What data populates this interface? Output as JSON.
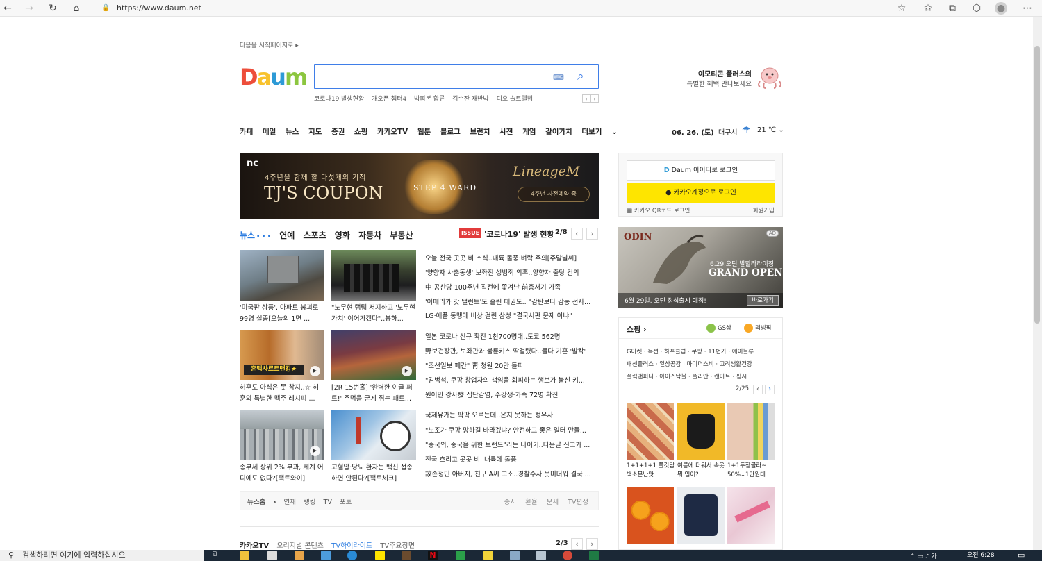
{
  "browser": {
    "url": "https://www.daum.net"
  },
  "header": {
    "start_page": "다음을 시작페이지로",
    "search": {
      "value": "",
      "placeholder": ""
    },
    "trending": [
      "코로나19 발생현황",
      "개오픈 챕터4",
      "박회본 합류",
      "김수잔 재반박",
      "디오 솔트엘범"
    ],
    "promo": {
      "title": "이모티콘 플러스의",
      "subtitle": "특별한 혜택 만나보세요"
    }
  },
  "nav": {
    "items": [
      "카페",
      "메일",
      "뉴스",
      "지도",
      "증권",
      "쇼핑",
      "카카오TV",
      "웹툰",
      "블로그",
      "브런치",
      "사전",
      "게임",
      "같이가치",
      "더보기"
    ],
    "date": "06. 26. (토)",
    "city": "대구시",
    "temp": "21 ℃"
  },
  "banner": {
    "brand": "nc",
    "tagline": "4주년을 함께 할 다섯개의 기적",
    "headline": "TJ'S COUPON",
    "center": "STEP 4 WARD",
    "game": "LineageM",
    "preregister": "4주년 사전예약 중"
  },
  "news": {
    "tabs": [
      "뉴스",
      "연예",
      "스포츠",
      "영화",
      "자동차",
      "부동산"
    ],
    "issue_tag": "ISSUE",
    "issue_title": "'코로나19' 발생 현황",
    "page": "2/8",
    "thumbs": [
      {
        "caption": "'미국판 삼풍'..아파트 붕괴로 99명 실종[오늘의 1면 ..."
      },
      {
        "caption": "\"노무현 탬퉤 저지하고 '노무현 가치' 이어가겠다\"..봉하..."
      },
      {
        "caption": "허훈도 아식은 못 참지..☆ 허훈의 특별한 맥주 레시피 ..."
      },
      {
        "caption": "[2R 15번홀] '완벽한 이글 퍼트!' 주먹을 굳게 쥐는 패트..."
      },
      {
        "caption": "종부세 상위 2% 부과, 세계 어디에도 없다?[팩트와이]"
      },
      {
        "caption": "고혈압·당뇨 환자는 백신 접종하면 안된다?[팩트체크]"
      }
    ],
    "headlines": [
      "오늘 전국 곳곳 비 소식..내륙 돌풍·벼락 주의[주말날씨]",
      "'양향자 사촌동생' 보좌진 성범죄 의혹..양향자 출당 건의",
      "中 공산당 100주년 직전에 쫓겨난 前총서기 가족",
      "'아메리카 갓 탤런트'도 홀린 태권도.. \"감탄보다 감동 선사...",
      "LG·애플 동맹에 비상 걸린 삼성 \"결국시판 문제 아냐\"",
      "일본 코로나 신규 확진 1천700명대..도쿄 562명",
      "野보건장관, 보좌관과 불륜키스 딱걸렸다..물다 기혼 '발칵'",
      "\"조선일보 폐간\" 靑 청원 20만 돌파",
      "\"김범석, 쿠팡 창업자의 책임을 회피하는 행보가 불신 키...",
      "원어민 강사發 집단감염, 수강생·가족 72명 확진",
      "국제유가는 팍팍 오르는데..온지 못하는 정유사",
      "\"노조가 쿠팡 망하길 바라겠냐? 안전하고 좋은 일터 만들...",
      "\"중국의, 중국을 위한 브랜드\"라는 나이키..다음날 신고가 ...",
      "전국 흐리고 곳곳 비..내륙에 돌풍",
      "故손정민 아버지, 친구 A씨 고소..경찰수사 못미더워 결국 ..."
    ],
    "footer_left": [
      "뉴스홈",
      "연재",
      "랭킹",
      "TV",
      "포토"
    ],
    "footer_right": [
      "증시",
      "환율",
      "운세",
      "TV편성"
    ]
  },
  "kakaotv": {
    "title": "카카오TV",
    "tabs": [
      "오리지널 콘텐츠",
      "TV하이라이트",
      "TV주요장면"
    ],
    "page": "2/3"
  },
  "login": {
    "daum": "Daum 아이디로 로그인",
    "kakao": "카카오계정으로 로그인",
    "qr": "카카오 QR코드 로그인",
    "join": "회원가입"
  },
  "ad": {
    "tag": "AD",
    "brand": "ODIN",
    "date": "6.29.오딘 발할라라이징",
    "headline": "GRAND OPEN",
    "bottom": "6월 29일, 오딘 정식출시 예정!",
    "button": "바로가기"
  },
  "shopping": {
    "title": "쇼핑",
    "partners": [
      "GS샵",
      "리빙픽"
    ],
    "links": [
      "G마켓 · 옥션 · 하프클럽 · 쿠팡 · 11번가 · 에이블루",
      "패션플러스 · 일상공감 · 마이더스비 · 고려생활건강",
      "플릭앤퍼니 · 아이스탁볼 · 플리안 · 캔마트 · 핑시"
    ],
    "page": "2/25",
    "items": [
      {
        "caption": "1+1+1+1 쫄깃담백소문난맛"
      },
      {
        "caption": "여름에 더워서 속옷 뭐 입어?"
      },
      {
        "caption": "1+1두장골라~ 50%↓1만원대"
      }
    ]
  },
  "taskbar": {
    "search": "검색하려면 여기에 입력하십시오",
    "time": "오전 6:28"
  }
}
